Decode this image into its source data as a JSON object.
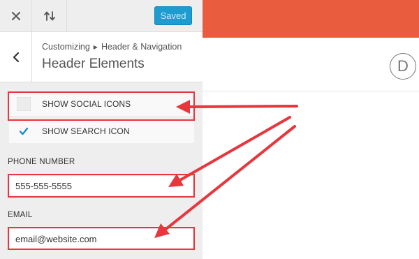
{
  "toolbar": {
    "close_icon": "close-icon",
    "reorder_icon": "reorder-arrows-icon",
    "saved_label": "Saved"
  },
  "section": {
    "back_icon": "chevron-left-icon",
    "breadcrumb_root": "Customizing",
    "breadcrumb_parent": "Header & Navigation",
    "title": "Header Elements"
  },
  "controls": {
    "social_icons_label": "SHOW SOCIAL ICONS",
    "social_icons_checked": false,
    "search_icon_label": "SHOW SEARCH ICON",
    "search_icon_checked": true,
    "phone_label": "PHONE NUMBER",
    "phone_value": "555-555-5555",
    "email_label": "EMAIL",
    "email_value": "email@website.com"
  },
  "preview": {
    "logo_letter": "D"
  },
  "colors": {
    "accent_blue": "#1c9ccf",
    "header_orange": "#e95c3d",
    "annotation_red": "#e8363d"
  }
}
